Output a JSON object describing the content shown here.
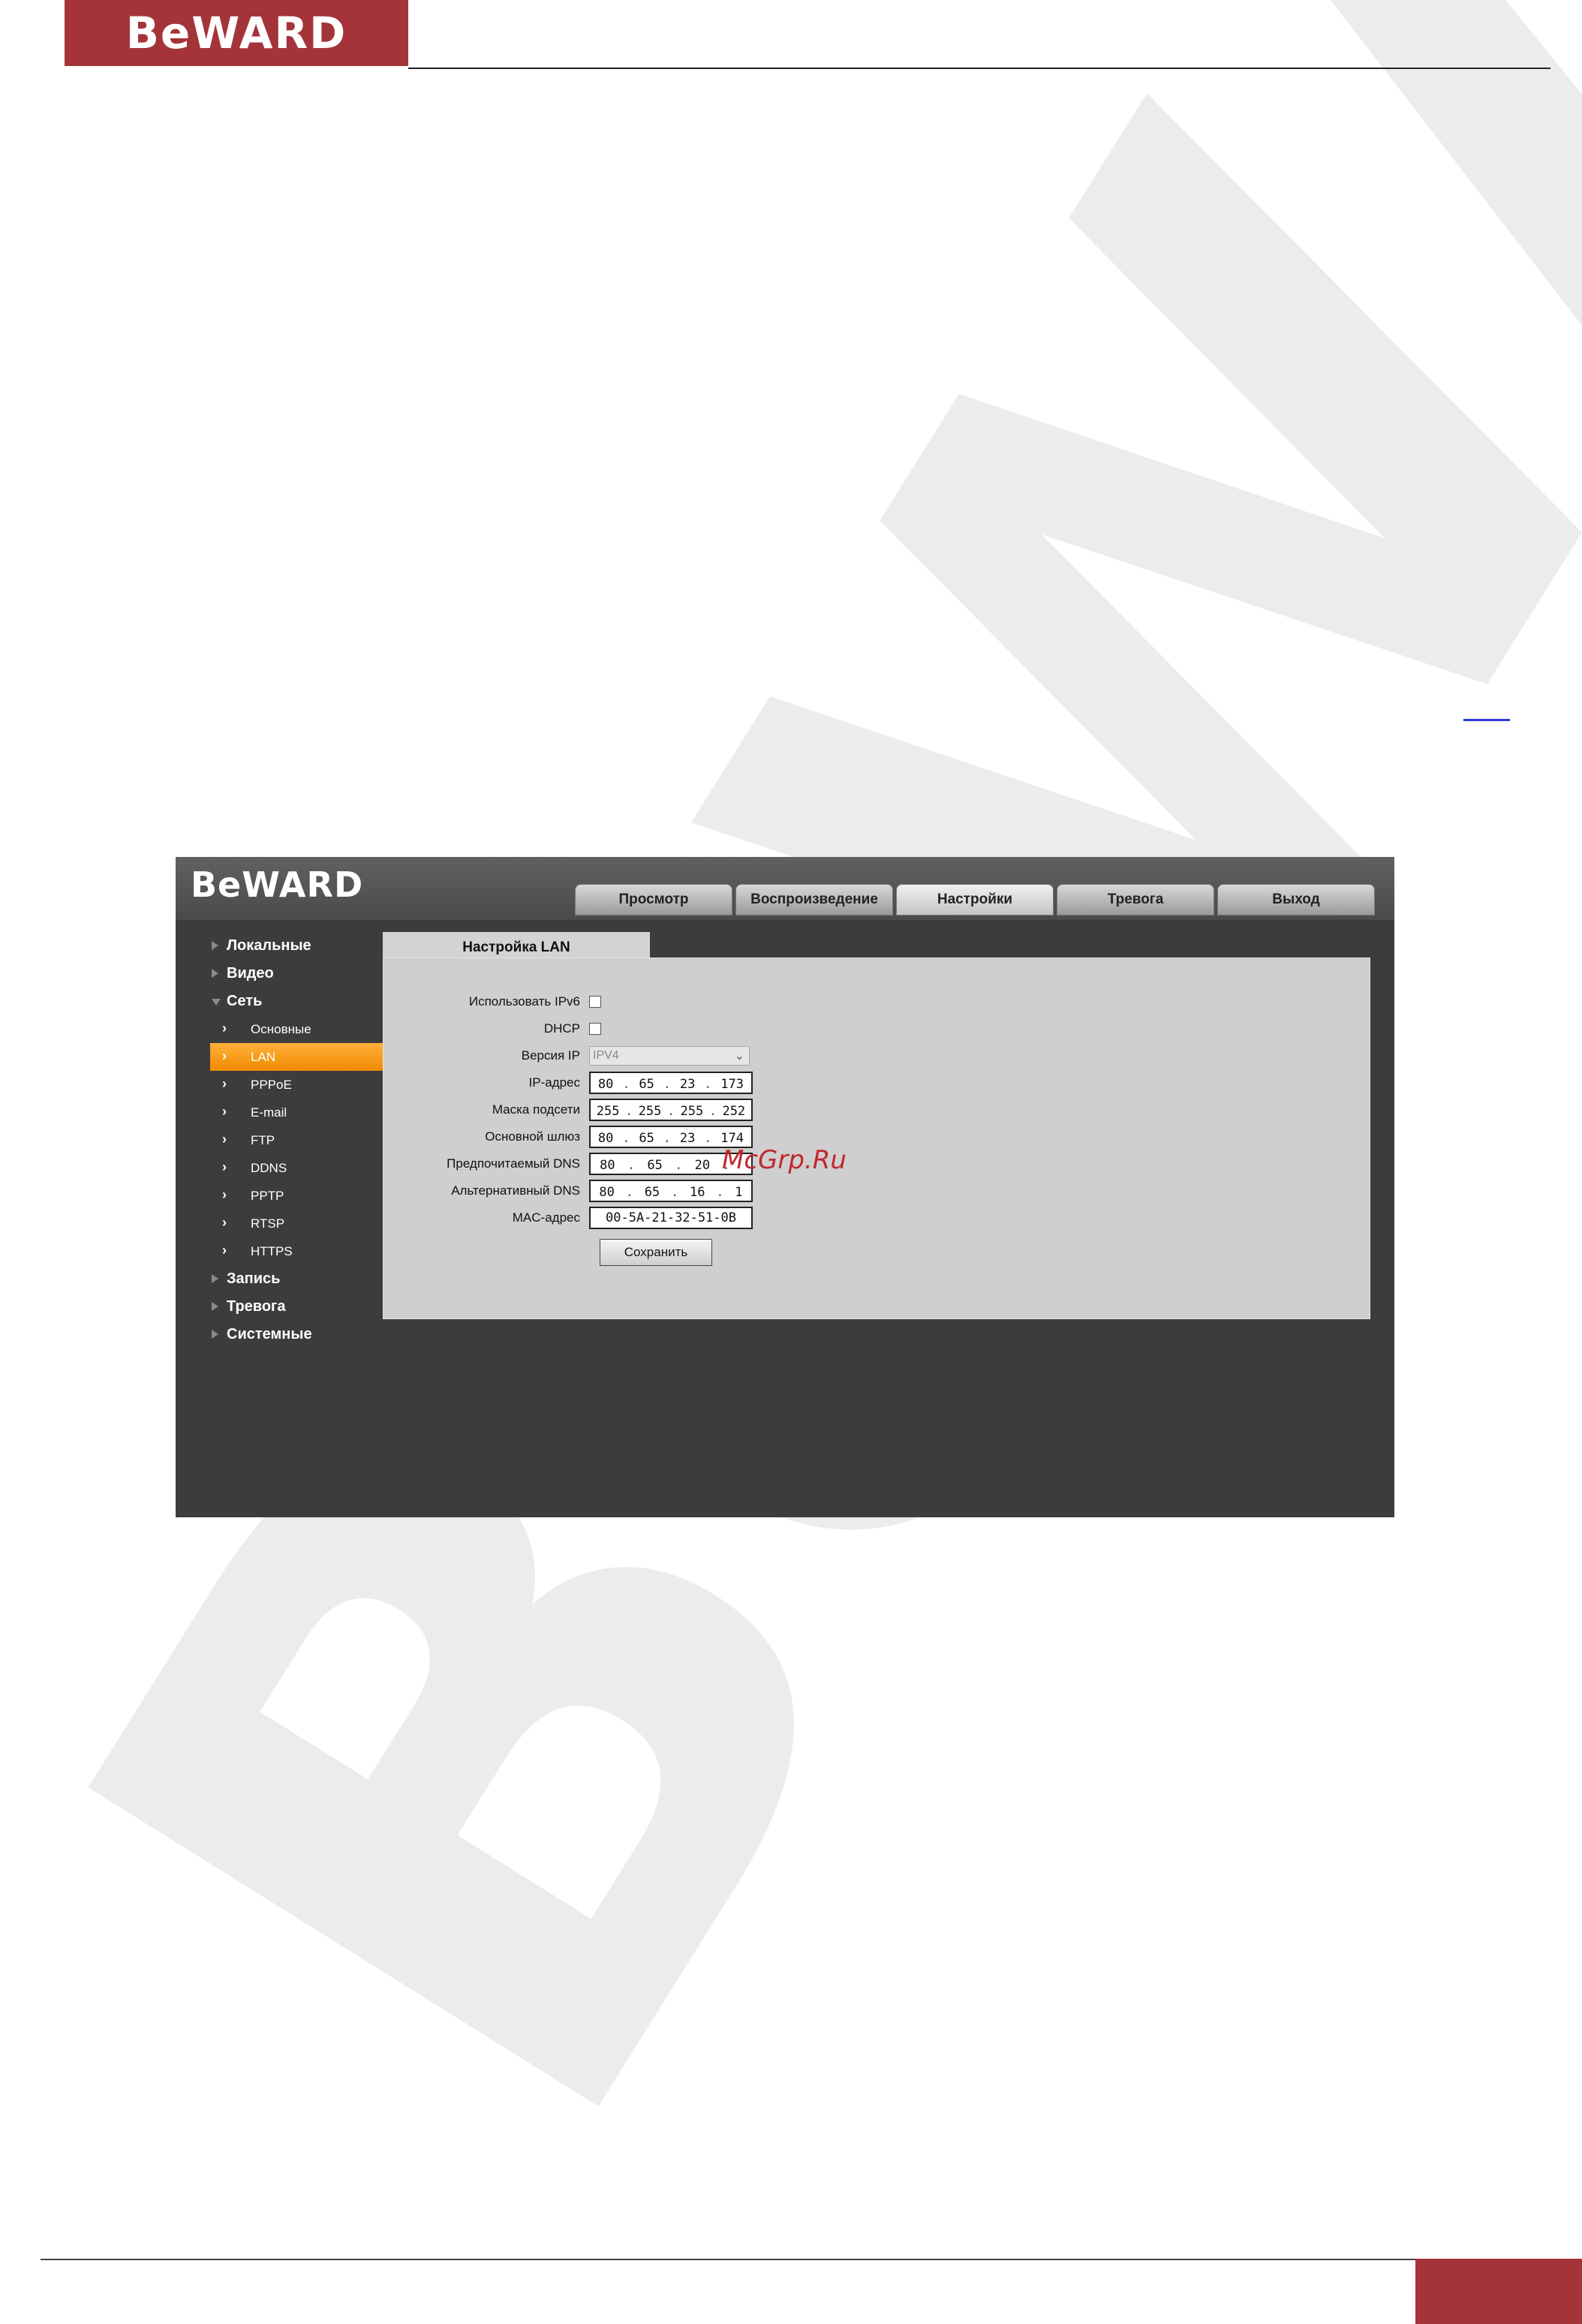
{
  "document": {
    "logo_text": "BeWARD"
  },
  "app": {
    "logo_text": "BeWARD",
    "tabs": [
      "Просмотр",
      "Воспроизведение",
      "Настройки",
      "Тревога",
      "Выход"
    ],
    "active_tab": "Настройки",
    "sidebar": {
      "sections": [
        "Локальные",
        "Видео",
        "Сеть",
        "Запись",
        "Тревога",
        "Системные"
      ],
      "network_items": [
        "Основные",
        "LAN",
        "PPPoE",
        "E-mail",
        "FTP",
        "DDNS",
        "PPTP",
        "RTSP",
        "HTTPS"
      ],
      "active_item": "LAN"
    },
    "panel": {
      "title": "Настройка LAN",
      "fields": {
        "ipv6_label": "Использовать IPv6",
        "dhcp_label": "DHCP",
        "ip_version_label": "Версия IP",
        "ip_version_value": "IPV4",
        "ip_label": "IP-адрес",
        "ip": [
          "80",
          "65",
          "23",
          "173"
        ],
        "mask_label": "Маска подсети",
        "mask": [
          "255",
          "255",
          "255",
          "252"
        ],
        "gateway_label": "Основной шлюз",
        "gateway": [
          "80",
          "65",
          "23",
          "174"
        ],
        "dns1_label": "Предпочитаемый DNS",
        "dns1": [
          "80",
          "65",
          "20",
          ""
        ],
        "dns2_label": "Альтернативный DNS",
        "dns2": [
          "80",
          "65",
          "16",
          "1"
        ],
        "mac_label": "MAC-адрес",
        "mac": "00-5A-21-32-51-0B"
      },
      "save_label": "Сохранить"
    }
  },
  "watermark_text": "McGrp.Ru",
  "colors": {
    "brand": "#a4343a",
    "active_item": "#f39a12"
  }
}
